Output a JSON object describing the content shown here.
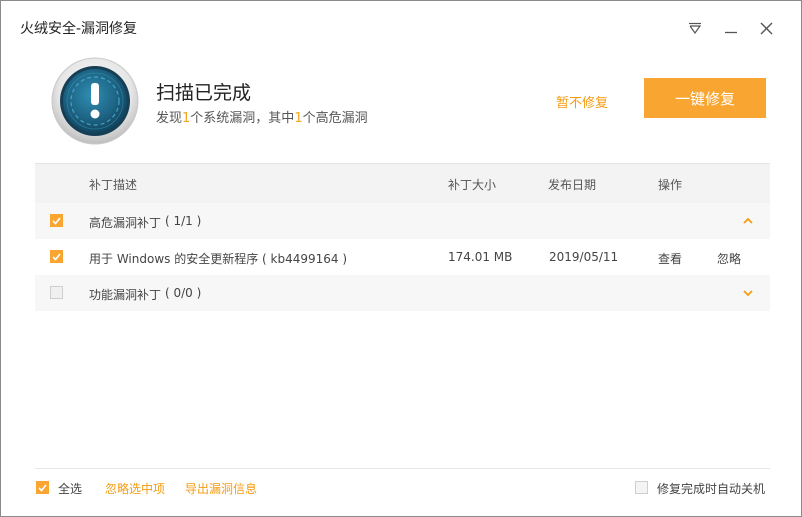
{
  "window": {
    "title": "火绒安全-漏洞修复"
  },
  "colors": {
    "accent": "#f8a631",
    "link": "#f39c12",
    "shield": "#1e6b8c"
  },
  "icons": {
    "menu": "triangle-down-icon",
    "minimize": "minimize-icon",
    "close": "close-icon",
    "status": "alert-shield-icon"
  },
  "header": {
    "status_title": "扫描已完成",
    "summary_prefix": "发现",
    "summary_count": "1",
    "summary_mid": "个系统漏洞，其中",
    "summary_high": "1",
    "summary_suffix": "个高危漏洞",
    "defer_label": "暂不修复",
    "fix_all_label": "一键修复"
  },
  "table": {
    "columns": [
      "补丁描述",
      "补丁大小",
      "发布日期",
      "操作"
    ],
    "groups": [
      {
        "label": "高危漏洞补丁",
        "count": "( 1/1 )",
        "checked": true,
        "expanded": true,
        "items": [
          {
            "description": "用于 Windows 的安全更新程序 ( kb4499164 )",
            "size": "174.01 MB",
            "date": "2019/05/11",
            "view_label": "查看",
            "ignore_label": "忽略",
            "checked": true
          }
        ]
      },
      {
        "label": "功能漏洞补丁",
        "count": "( 0/0 )",
        "checked": false,
        "expanded": false,
        "items": []
      }
    ]
  },
  "footer": {
    "select_all_label": "全选",
    "ignore_selected_label": "忽略选中项",
    "export_label": "导出漏洞信息",
    "auto_shutdown_label": "修复完成时自动关机"
  }
}
